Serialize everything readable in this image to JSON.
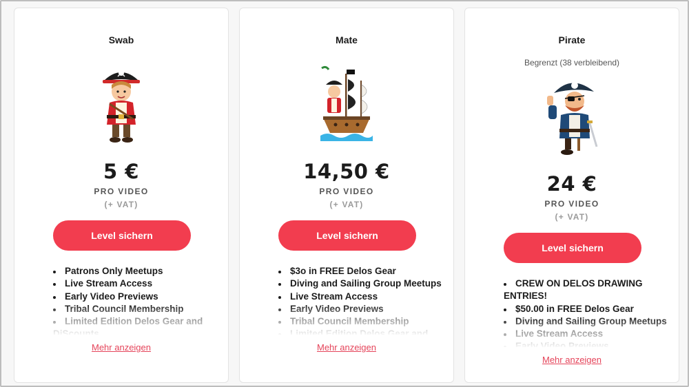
{
  "tiers": [
    {
      "name": "Swab",
      "limited": "",
      "price": "5 €",
      "per": "PRO VIDEO",
      "vat": "(+ VAT)",
      "button": "Level sichern",
      "benefits": [
        "Patrons Only Meetups",
        "Live Stream Access",
        "Early Video Previews",
        "Tribal Council Membership",
        "Limited Edition Delos Gear and DiScounts"
      ],
      "more": "Mehr anzeigen"
    },
    {
      "name": "Mate",
      "limited": "",
      "price": "14,50 €",
      "per": "PRO VIDEO",
      "vat": "(+ VAT)",
      "button": "Level sichern",
      "benefits": [
        "$3o in FREE Delos Gear",
        "Diving and Sailing Group Meetups",
        "Live Stream Access",
        "Early Video Previews",
        "Tribal Council Membership",
        "Limited Edition Delos Gear and"
      ],
      "more": "Mehr anzeigen"
    },
    {
      "name": "Pirate",
      "limited": "Begrenzt (38 verbleibend)",
      "price": "24 €",
      "per": "PRO VIDEO",
      "vat": "(+ VAT)",
      "button": "Level sichern",
      "benefits": [
        "CREW ON DELOS DRAWING ENTRIES!",
        "$50.00 in FREE Delos Gear",
        "Diving and Sailing Group Meetups",
        "Live Stream Access",
        "Early Video Previews"
      ],
      "more": "Mehr anzeigen"
    }
  ],
  "colors": {
    "accent": "#f23d4f",
    "link": "#e5445a",
    "text": "#1b1b1b",
    "muted": "#555555"
  },
  "icons": {
    "tier1": "pirate-boy-icon",
    "tier2": "pirate-ship-icon",
    "tier3": "pirate-captain-icon"
  }
}
